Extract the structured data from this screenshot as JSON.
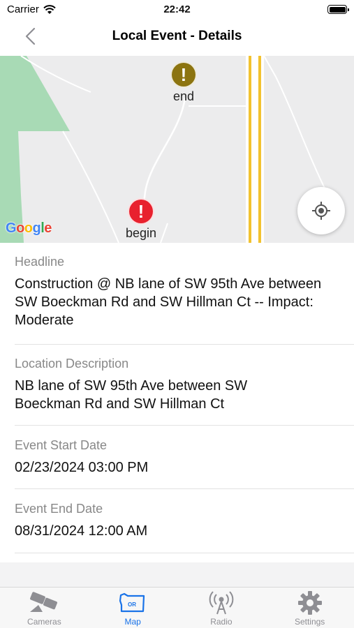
{
  "status_bar": {
    "carrier": "Carrier",
    "time": "22:42"
  },
  "nav": {
    "title": "Local Event - Details"
  },
  "map": {
    "markers": [
      {
        "label": "end",
        "glyph": "!",
        "color": "#8c7410"
      },
      {
        "label": "begin",
        "glyph": "!",
        "color": "#e8212e"
      }
    ],
    "attribution": "Google"
  },
  "details": {
    "headline": {
      "label": "Headline",
      "value": "Construction @ NB lane of SW 95th Ave between SW Boeckman Rd and SW Hillman Ct -- Impact: Moderate"
    },
    "location": {
      "label": "Location Description",
      "value": "NB lane of SW 95th Ave between SW Boeckman Rd and SW Hillman Ct"
    },
    "start": {
      "label": "Event Start Date",
      "value": "02/23/2024 03:00 PM"
    },
    "end": {
      "label": "Event End Date",
      "value": "08/31/2024 12:00 AM"
    }
  },
  "tabs": [
    {
      "label": "Cameras",
      "icon": "camera-icon",
      "active": false
    },
    {
      "label": "Map",
      "icon": "oregon-map-icon",
      "active": true
    },
    {
      "label": "Radio",
      "icon": "radio-tower-icon",
      "active": false
    },
    {
      "label": "Settings",
      "icon": "gear-icon",
      "active": false
    }
  ],
  "colors": {
    "accent": "#1a73e8",
    "inactive": "#8e8e93",
    "park": "#a8dab5",
    "road": "#f2c230"
  }
}
